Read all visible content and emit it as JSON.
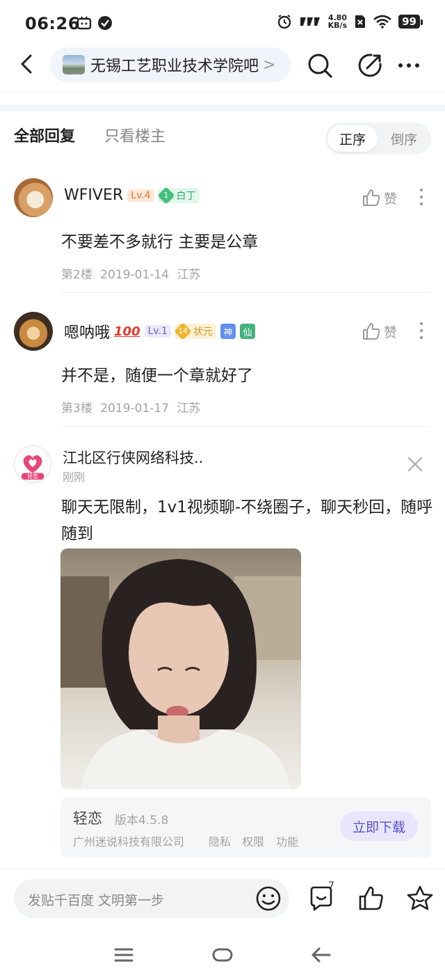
{
  "status_bar": {
    "time": "06:26",
    "net_speed_value": "4.80",
    "net_speed_unit": "KB/s",
    "battery": "99"
  },
  "nav": {
    "forum_name": "无锡工艺职业技术学院吧",
    "forum_arrow": ">"
  },
  "tabs": {
    "all_replies": "全部回复",
    "owner_only": "只看楼主",
    "order_asc": "正序",
    "order_desc": "倒序"
  },
  "replies": [
    {
      "username": "WFIVER",
      "level": "Lv.4",
      "rank_num": "1",
      "rank_title": "白丁",
      "like_label": "赞",
      "text": "不要差不多就行 主要是公章",
      "floor": "第2楼",
      "date": "2019-01-14",
      "location": "江苏"
    },
    {
      "username": "嗯呐哦",
      "emoji": "100",
      "level": "Lv.1",
      "rank_num": "14",
      "rank_title": "状元",
      "tag1": "神",
      "tag2": "仙",
      "like_label": "赞",
      "text": "并不是，随便一个章就好了",
      "floor": "第3楼",
      "date": "2019-01-17",
      "location": "江苏"
    }
  ],
  "ad": {
    "advertiser": "江北区行侠网络科技..",
    "time": "刚刚",
    "logo_text": "轻恋",
    "text": "聊天无限制，1v1视频聊-不绕圈子，聊天秒回，随呼随到",
    "app_name": "轻恋",
    "version": "版本4.5.8",
    "company": "广州迷说科技有限公司",
    "privacy": "隐私",
    "permissions": "权限",
    "features": "功能",
    "download": "立即下载"
  },
  "bottom_bar": {
    "placeholder": "发贴千百度 文明第一步",
    "comment_count": "7"
  },
  "colors": {
    "accent_purple": "#5b4fc9",
    "level4": "#d9793b",
    "level1": "#6b5fc9",
    "rank_green": "#43c07e",
    "rank_gold": "#f1b42f",
    "ad_logo_pink": "#e8457a"
  },
  "icons": {
    "status": [
      "bilibili-icon",
      "check-circle-icon",
      "alarm-icon",
      "signal-icon",
      "sim-off-icon",
      "wifi-icon",
      "battery-icon"
    ],
    "nav": [
      "back-arrow-icon",
      "search-icon",
      "share-icon",
      "more-icon"
    ],
    "bottom": [
      "emoji-icon",
      "comment-icon",
      "thumb-up-icon",
      "star-icon"
    ],
    "system": [
      "menu-icon",
      "home-icon",
      "back-icon"
    ]
  }
}
